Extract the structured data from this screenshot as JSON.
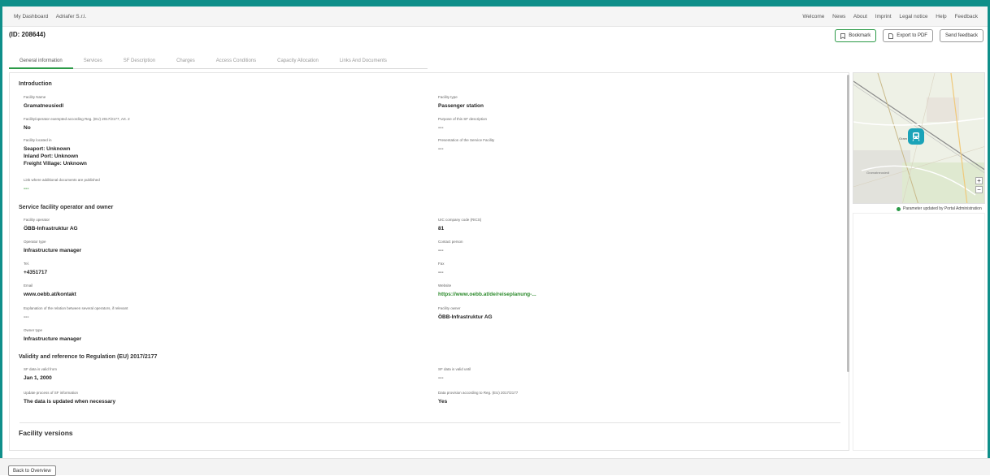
{
  "topbar": {
    "left": [
      "My Dashboard",
      "Adriafer S.r.l."
    ],
    "right": [
      "Welcome",
      "News",
      "About",
      "Imprint",
      "Legal notice",
      "Help",
      "Feedback"
    ]
  },
  "header": {
    "id_title": "(ID: 208644)",
    "buttons": {
      "bookmark": "Bookmark",
      "export": "Export to PDF",
      "feedback": "Send feedback"
    }
  },
  "tabs": [
    "General information",
    "Services",
    "SF Description",
    "Charges",
    "Access Conditions",
    "Capacity Allocation",
    "Links And Documents"
  ],
  "intro": {
    "title": "Introduction",
    "facility_name_label": "Facility Name",
    "facility_name": "Gramatneusiedl",
    "facility_type_label": "Facility type",
    "facility_type": "Passenger station",
    "exempted_label": "Facility/operator exempted according Reg. (EU) 2017/2177, Art. 2",
    "exempted": "No",
    "purpose_label": "Purpose of this SF description",
    "purpose": "---",
    "located_label": "Facility located in",
    "located": [
      "Seaport: Unknown",
      "Inland Port: Unknown",
      "Freight Village: Unknown"
    ],
    "presentation_label": "Presentation of the Service Facility",
    "presentation": "---",
    "link_label": "Link where additional documents are published",
    "link": "---"
  },
  "operator": {
    "title": "Service facility operator and owner",
    "facility_operator_label": "Facility operator",
    "facility_operator": "ÖBB-Infrastruktur AG",
    "uic_label": "UIC company code (RICS)",
    "uic": "81",
    "operator_type_label": "Operator type",
    "operator_type": "Infrastructure manager",
    "contact_label": "Contact person",
    "contact": "---",
    "tel_label": "Tel.",
    "tel": "+4351717",
    "fax_label": "Fax",
    "fax": "---",
    "email_label": "Email",
    "email": "www.oebb.at/kontakt",
    "website_label": "Website",
    "website": "https://www.oebb.at/de/reiseplanung-...",
    "explanation_label": "Explanation of the relation between several operators, if relevant",
    "explanation": "---",
    "owner_label": "Facility owner",
    "owner": "ÖBB-Infrastruktur AG",
    "owner_type_label": "Owner type",
    "owner_type": "Infrastructure manager"
  },
  "validity": {
    "title": "Validity and reference to Regulation (EU) 2017/2177",
    "valid_from_label": "SF data is valid from",
    "valid_from": "Jan 1, 2000",
    "valid_until_label": "SF data is valid until",
    "valid_until": "---",
    "update_label": "Update process of SF information",
    "update": "The data is updated when necessary",
    "provision_label": "Data provision according to Reg. (EU) 2017/2177",
    "provision": "Yes"
  },
  "facility_versions": "Facility versions",
  "map": {
    "town_label": "Gram",
    "town_label2": "Gramatneusiedl",
    "zoom_in": "+",
    "zoom_out": "−",
    "marker_color": "#1aa3b8"
  },
  "legend": "Parameter updated by Portal Administration",
  "back_button": "Back to Overview",
  "colors": {
    "accent": "#0f8f8a",
    "link": "#2b8a2b",
    "legend_dot": "#2b9a47"
  }
}
